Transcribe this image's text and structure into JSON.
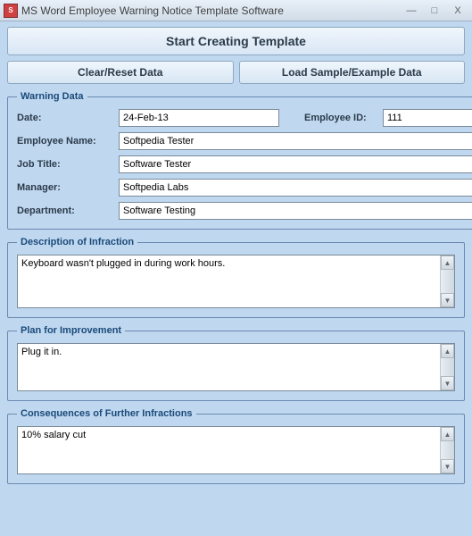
{
  "window": {
    "title": "MS Word Employee Warning Notice Template Software",
    "minimize": "—",
    "maximize": "□",
    "close": "X"
  },
  "buttons": {
    "start": "Start Creating Template",
    "clear": "Clear/Reset Data",
    "load": "Load Sample/Example Data"
  },
  "groups": {
    "warning": "Warning Data",
    "infraction": "Description of Infraction",
    "plan": "Plan for Improvement",
    "consequences": "Consequences of Further Infractions"
  },
  "labels": {
    "date": "Date:",
    "employeeId": "Employee ID:",
    "employeeName": "Employee Name:",
    "jobTitle": "Job Title:",
    "manager": "Manager:",
    "department": "Department:"
  },
  "values": {
    "date": "24-Feb-13",
    "employeeId": "111",
    "employeeName": "Softpedia Tester",
    "jobTitle": "Software Tester",
    "manager": "Softpedia Labs",
    "department": "Software Testing",
    "infraction": "Keyboard wasn't plugged in during work hours.",
    "plan": "Plug it in.",
    "consequences": "10% salary cut"
  },
  "scroll": {
    "up": "▲",
    "down": "▼"
  }
}
